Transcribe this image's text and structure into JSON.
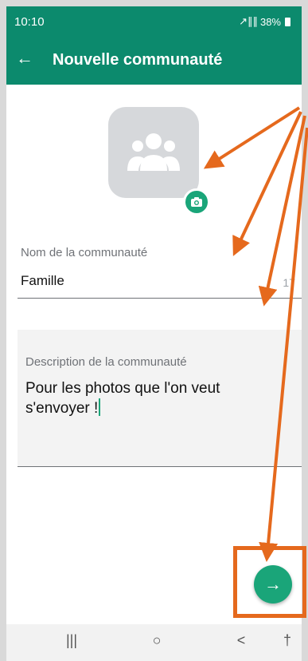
{
  "status_bar": {
    "time": "10:10",
    "icons": "⦿∷.∥",
    "battery": "38%"
  },
  "app_bar": {
    "back_icon": "←",
    "title": "Nouvelle communauté"
  },
  "name_field": {
    "label": "Nom de la communauté",
    "value": "Famille",
    "counter": "17"
  },
  "description_field": {
    "label": "Description de la communauté",
    "value": "Pour les photos que l'on veut s'envoyer !"
  },
  "fab": {
    "icon": "→"
  },
  "nav_bar": {
    "recents": "|||",
    "home": "○",
    "back": "<",
    "accessibility": "†"
  },
  "colors": {
    "primary": "#0c8a6d",
    "accent": "#1aa579",
    "annotation": "#e5691d"
  }
}
